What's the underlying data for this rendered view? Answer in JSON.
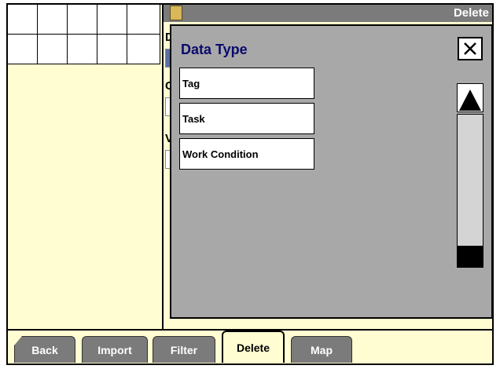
{
  "window": {
    "title": "Delete",
    "icon": "field-icon"
  },
  "background_labels": {
    "l1": "D",
    "l2": "C",
    "l3": "V"
  },
  "dialog": {
    "title": "Data Type",
    "close_icon": "close-icon",
    "items": [
      {
        "label": "Tag"
      },
      {
        "label": "Task"
      },
      {
        "label": "Work Condition"
      }
    ],
    "scroll_up_icon": "triangle-up-icon"
  },
  "tabs": [
    {
      "label": "Back"
    },
    {
      "label": "Import"
    },
    {
      "label": "Filter"
    },
    {
      "label": "Delete",
      "active": true
    },
    {
      "label": "Map"
    }
  ],
  "colors": {
    "panel_bg": "#fffdd1",
    "dialog_bg": "#a8a8a8",
    "title_blue": "#0a0a6e",
    "tab_gray": "#7b7b7b"
  }
}
